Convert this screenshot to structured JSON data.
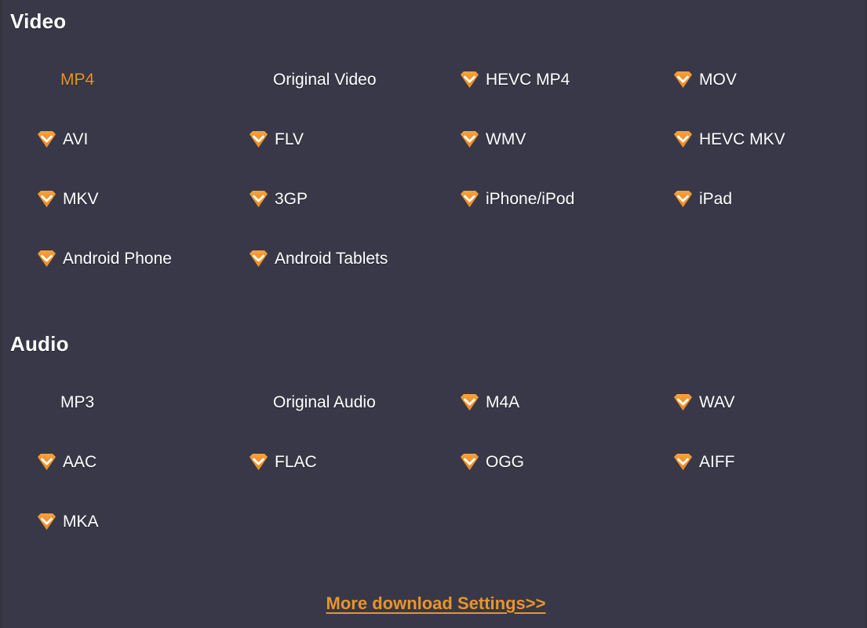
{
  "panel": {
    "background_color": "#383848",
    "accent_color": "#f0932d",
    "selected_text_color": "#e8952a",
    "text_color": "#ffffff"
  },
  "sections": [
    {
      "id": "video",
      "title": "Video",
      "rows": [
        [
          {
            "label": "MP4",
            "icon": "none",
            "selected": true
          },
          {
            "label": "Original Video",
            "icon": "none",
            "selected": false
          },
          {
            "label": "HEVC MP4",
            "icon": "gem-icon",
            "selected": false
          },
          {
            "label": "MOV",
            "icon": "gem-icon",
            "selected": false
          }
        ],
        [
          {
            "label": "AVI",
            "icon": "gem-icon",
            "selected": false
          },
          {
            "label": "FLV",
            "icon": "gem-icon",
            "selected": false
          },
          {
            "label": "WMV",
            "icon": "gem-icon",
            "selected": false
          },
          {
            "label": "HEVC MKV",
            "icon": "gem-icon",
            "selected": false
          }
        ],
        [
          {
            "label": "MKV",
            "icon": "gem-icon",
            "selected": false
          },
          {
            "label": "3GP",
            "icon": "gem-icon",
            "selected": false
          },
          {
            "label": "iPhone/iPod",
            "icon": "gem-icon",
            "selected": false
          },
          {
            "label": "iPad",
            "icon": "gem-icon",
            "selected": false
          }
        ],
        [
          {
            "label": "Android Phone",
            "icon": "gem-icon",
            "selected": false
          },
          {
            "label": "Android Tablets",
            "icon": "gem-icon",
            "selected": false
          }
        ]
      ]
    },
    {
      "id": "audio",
      "title": "Audio",
      "rows": [
        [
          {
            "label": "MP3",
            "icon": "none",
            "selected": false
          },
          {
            "label": "Original Audio",
            "icon": "none",
            "selected": false
          },
          {
            "label": "M4A",
            "icon": "gem-icon",
            "selected": false
          },
          {
            "label": "WAV",
            "icon": "gem-icon",
            "selected": false
          }
        ],
        [
          {
            "label": "AAC",
            "icon": "gem-icon",
            "selected": false
          },
          {
            "label": "FLAC",
            "icon": "gem-icon",
            "selected": false
          },
          {
            "label": "OGG",
            "icon": "gem-icon",
            "selected": false
          },
          {
            "label": "AIFF",
            "icon": "gem-icon",
            "selected": false
          }
        ],
        [
          {
            "label": "MKA",
            "icon": "gem-icon",
            "selected": false
          }
        ]
      ]
    }
  ],
  "footer": {
    "link_label": "More download Settings>>"
  }
}
